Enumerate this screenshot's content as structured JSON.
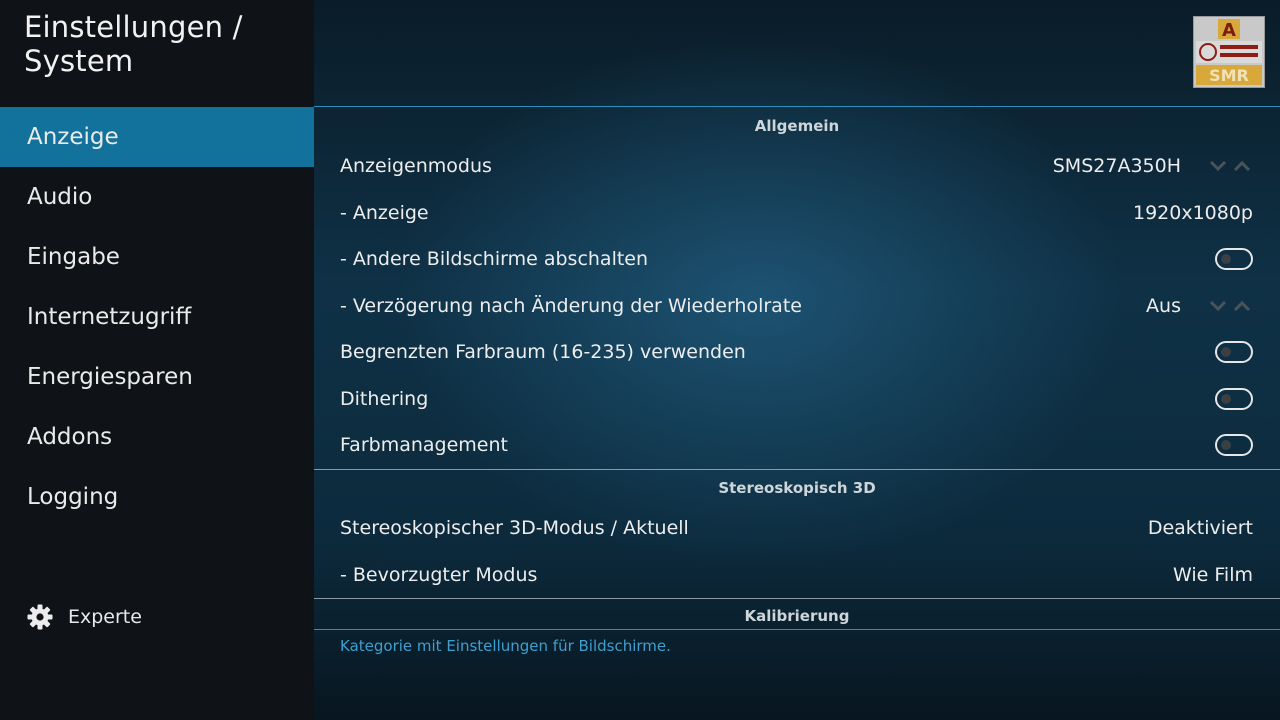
{
  "header": {
    "title": "Einstellungen / System"
  },
  "sidebar": {
    "items": [
      {
        "label": "Anzeige",
        "active": true
      },
      {
        "label": "Audio"
      },
      {
        "label": "Eingabe"
      },
      {
        "label": "Internetzugriff"
      },
      {
        "label": "Energiesparen"
      },
      {
        "label": "Addons"
      },
      {
        "label": "Logging"
      }
    ],
    "expert": {
      "label": "Experte",
      "icon": "gear-icon"
    }
  },
  "logo": {
    "line1": "A",
    "line2": "SMR",
    "line3": "SMR",
    "emblem": "seal-logo"
  },
  "sections": {
    "general": {
      "title": "Allgemein"
    },
    "stereo": {
      "title": "Stereoskopisch 3D"
    },
    "calibration": {
      "title": "Kalibrierung"
    }
  },
  "settings": {
    "display_mode": {
      "label": "Anzeigenmodus",
      "value": "SMS27A350H"
    },
    "display": {
      "label": "- Anzeige",
      "value": "1920x1080p"
    },
    "blank_other": {
      "label": "- Andere Bildschirme abschalten",
      "value": false
    },
    "refresh_delay": {
      "label": "- Verzögerung nach Änderung der Wiederholrate",
      "value": "Aus"
    },
    "limited_range": {
      "label": "Begrenzten Farbraum (16-235) verwenden",
      "value": false
    },
    "dithering": {
      "label": "Dithering",
      "value": false
    },
    "color_mgmt": {
      "label": "Farbmanagement",
      "value": false
    },
    "stereo_mode": {
      "label": "Stereoskopischer 3D-Modus / Aktuell",
      "value": "Deaktiviert"
    },
    "preferred_mode": {
      "label": "- Bevorzugter Modus",
      "value": "Wie Film"
    }
  },
  "footer": {
    "description": "Kategorie mit Einstellungen für Bildschirme."
  },
  "colors": {
    "accent": "#13729b",
    "description_text": "#3f9fd1",
    "sidebar_bg": "#0f1317"
  }
}
